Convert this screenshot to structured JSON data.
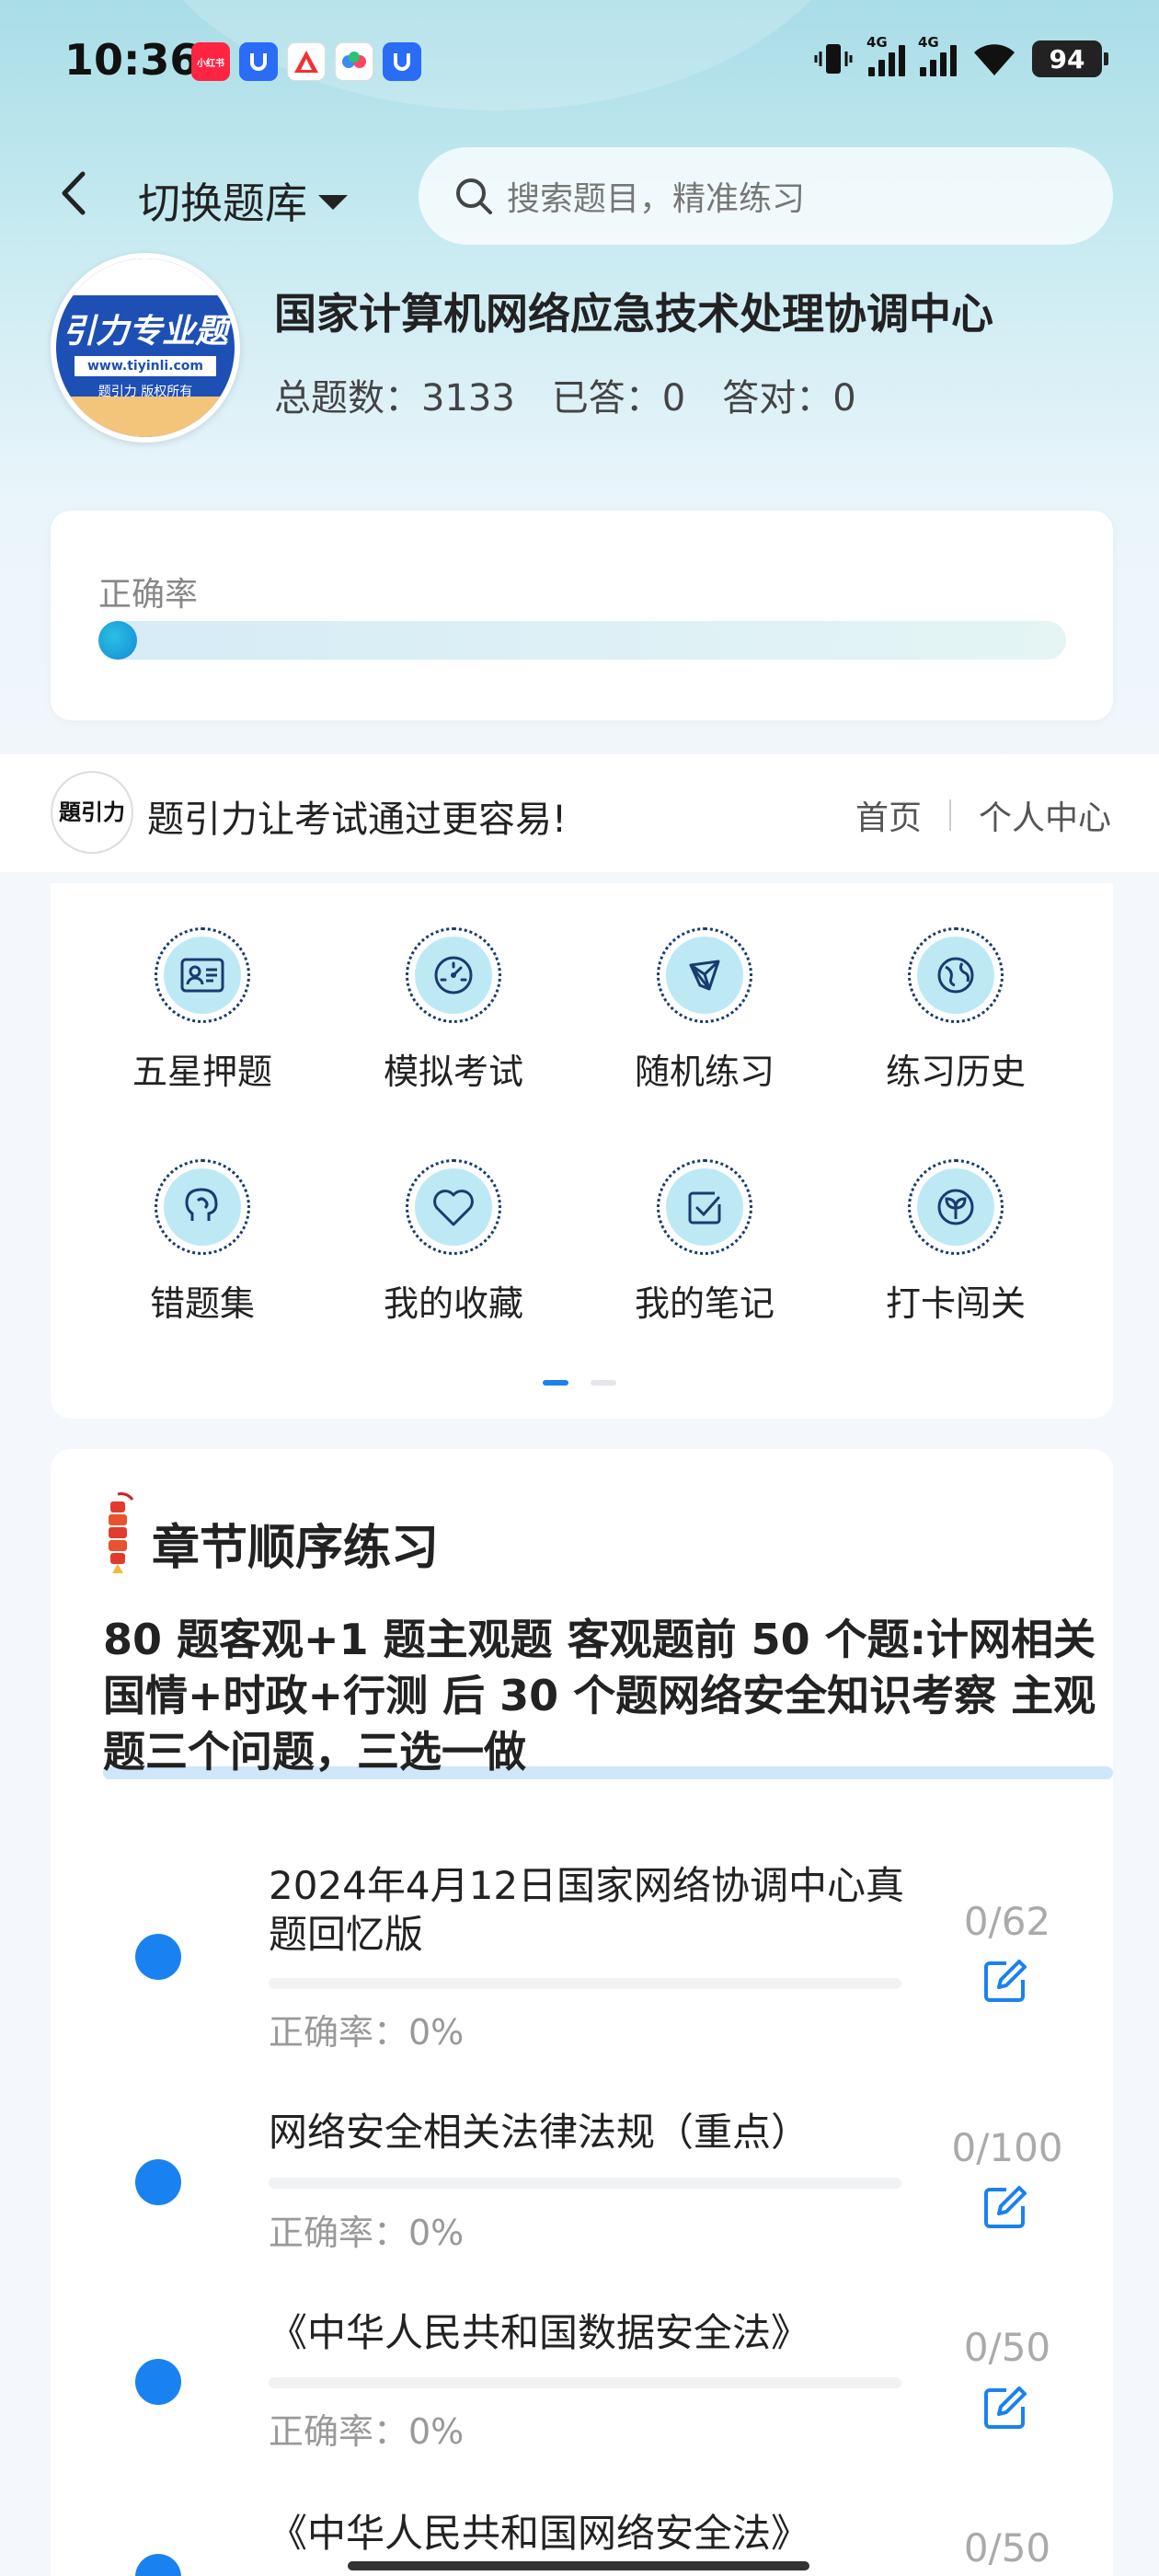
{
  "status_bar": {
    "time": "10:36",
    "battery": "94",
    "network_1": "4G",
    "network_2": "4G",
    "notif_1": "小红书"
  },
  "header": {
    "switch_label": "切换题库",
    "search_placeholder": "搜索题目，精准练习"
  },
  "bank": {
    "title": "国家计算机网络应急技术处理协调中心",
    "total": "总题数：3133",
    "answered": "已答：0",
    "correct": "答对：0",
    "logo_title": "引力专业题",
    "logo_url": "www.tiyinli.com",
    "logo_copy": "题引力 版权所有"
  },
  "accuracy": {
    "label": "正确率",
    "value": 0
  },
  "ad": {
    "logo_text": "題引力",
    "slogan": "题引力让考试通过更容易!",
    "link_home": "首页",
    "link_user": "个人中心"
  },
  "grid": [
    {
      "label": "五星押题",
      "icon": "id-card-icon"
    },
    {
      "label": "模拟考试",
      "icon": "gauge-icon"
    },
    {
      "label": "随机练习",
      "icon": "network-icon"
    },
    {
      "label": "练习历史",
      "icon": "globe-icon"
    },
    {
      "label": "错题集",
      "icon": "brain-icon"
    },
    {
      "label": "我的收藏",
      "icon": "heart-icon"
    },
    {
      "label": "我的笔记",
      "icon": "note-check-icon"
    },
    {
      "label": "打卡闯关",
      "icon": "sprout-icon"
    }
  ],
  "chapter": {
    "title": "章节顺序练习",
    "description": "80 题客观+1 题主观题 客观题前 50 个题:计网相关国情+时政+行测 后 30 个题网络安全知识考察 主观题三个问题，三选一做",
    "items": [
      {
        "title": "2024年4月12日国家网络协调中心真题回忆版",
        "accuracy": "正确率：0%",
        "count": "0/62"
      },
      {
        "title": "网络安全相关法律法规（重点）",
        "accuracy": "正确率：0%",
        "count": "0/100"
      },
      {
        "title": "《中华人民共和国数据安全法》",
        "accuracy": "正确率：0%",
        "count": "0/50"
      },
      {
        "title": "《中华人民共和国网络安全法》",
        "accuracy": "",
        "count": "0/50"
      }
    ]
  },
  "colors": {
    "accent": "#1a82f0",
    "icon_fill": "#bde9f5",
    "icon_stroke": "#1a3b6e"
  }
}
